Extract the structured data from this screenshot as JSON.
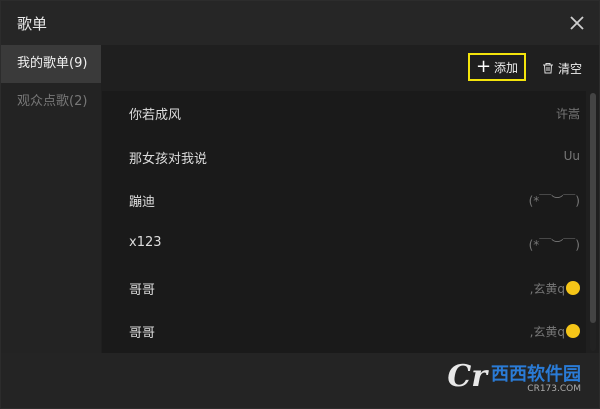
{
  "window": {
    "title": "歌单"
  },
  "sidebar": {
    "items": [
      {
        "label": "我的歌单(9)",
        "active": true
      },
      {
        "label": "观众点歌(2)",
        "active": false
      }
    ]
  },
  "toolbar": {
    "add_label": "添加",
    "clear_label": "清空"
  },
  "songs": [
    {
      "title": "你若成风",
      "singer": "许嵩"
    },
    {
      "title": "那女孩对我说",
      "singer": "Uu"
    },
    {
      "title": "蹦迪",
      "singer": "(*￣︶￣)"
    },
    {
      "title": "x123",
      "singer": "(*￣︶￣)"
    },
    {
      "title": "哥哥",
      "singer": ",玄黄q"
    },
    {
      "title": "哥哥",
      "singer": ",玄黄q"
    }
  ],
  "watermark": {
    "logo": "Cr",
    "brand": "西西软件园",
    "url": "CR173.COM"
  },
  "colors": {
    "highlight": "#f4e40c",
    "background": "#1f1f1f"
  }
}
